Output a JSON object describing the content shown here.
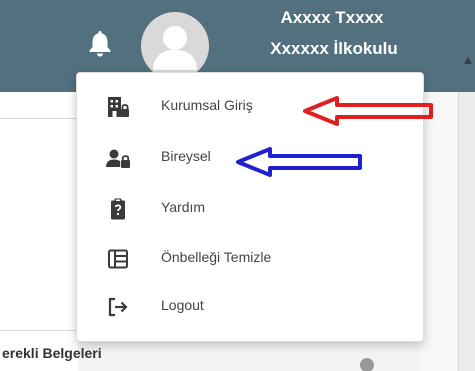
{
  "header": {
    "user_name": "Axxxx Txxxx",
    "school_name": "Xxxxxx İlkokulu",
    "bell_icon": "bell-icon",
    "avatar_icon": "user-avatar-icon"
  },
  "menu": {
    "items": [
      {
        "label": "Kurumsal Giriş",
        "icon": "building-lock-icon"
      },
      {
        "label": "Bireysel",
        "icon": "user-lock-icon"
      },
      {
        "label": "Yardım",
        "icon": "clipboard-question-icon"
      },
      {
        "label": "Önbelleği Temizle",
        "icon": "cache-clear-icon"
      },
      {
        "label": "Logout",
        "icon": "logout-icon"
      }
    ]
  },
  "background": {
    "card_title": "erekli Belgeleri"
  },
  "annotations": {
    "red_arrow_color": "#e02020",
    "blue_arrow_color": "#2020d0"
  },
  "colors": {
    "header_bg": "#53707f",
    "menu_text": "#444444",
    "icon_color": "#3a3a3a"
  }
}
